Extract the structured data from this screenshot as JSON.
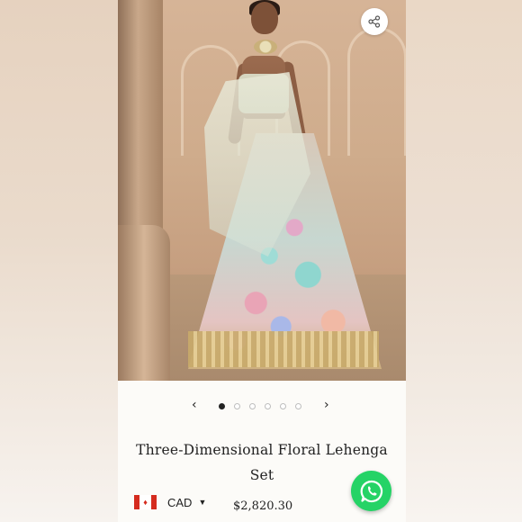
{
  "product": {
    "title": "Three-Dimensional Floral Lehenga Set",
    "price": "$2,820.30"
  },
  "carousel": {
    "prev_icon": "chevron-left-icon",
    "next_icon": "chevron-right-icon",
    "prev_glyph": "‹",
    "next_glyph": "›",
    "dot_count": 6,
    "active_index": 0
  },
  "currency": {
    "code": "CAD",
    "flag_icon": "canada-flag-icon",
    "caret_glyph": "▼"
  },
  "icons": {
    "share": "share-icon",
    "whatsapp": "whatsapp-icon"
  },
  "colors": {
    "whatsapp_green": "#25d366",
    "text": "#222222",
    "dot_active": "#222222",
    "dot_inactive_border": "#bdbdbd"
  }
}
